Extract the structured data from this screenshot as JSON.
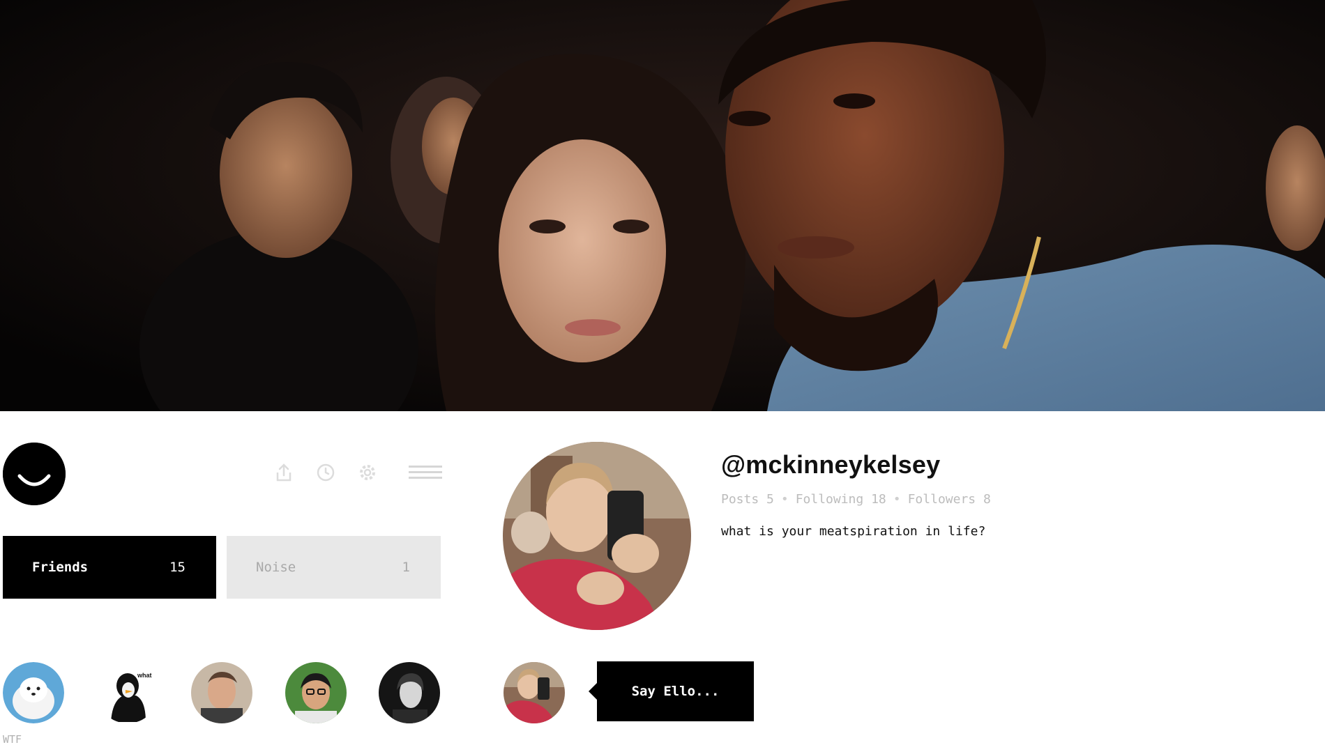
{
  "header": {
    "logo_icon": "ello-smile-icon",
    "toolbar_icons": [
      "share-icon",
      "clock-icon",
      "gear-icon",
      "hamburger-menu-icon"
    ]
  },
  "streams": {
    "friends": {
      "label": "Friends",
      "count": "15"
    },
    "noise": {
      "label": "Noise",
      "count": "1"
    }
  },
  "following_avatars": [
    {
      "name": "samoyed-dog-avatar"
    },
    {
      "name": "penguin-avatar"
    },
    {
      "name": "man-portrait-avatar"
    },
    {
      "name": "glasses-woman-avatar"
    },
    {
      "name": "bw-portrait-avatar"
    }
  ],
  "wtf_label": "WTF",
  "profile": {
    "username": "@mckinneykelsey",
    "posts_label": "Posts 5",
    "following_label": "Following 18",
    "followers_label": "Followers 8",
    "separator": "•",
    "bio": "what is your meatspiration in life?"
  },
  "composer": {
    "placeholder": "Say Ello..."
  },
  "colors": {
    "primary": "#000000",
    "background": "#ffffff",
    "noise_bg": "#e8e8e8",
    "muted_text": "#bcbcbc"
  }
}
